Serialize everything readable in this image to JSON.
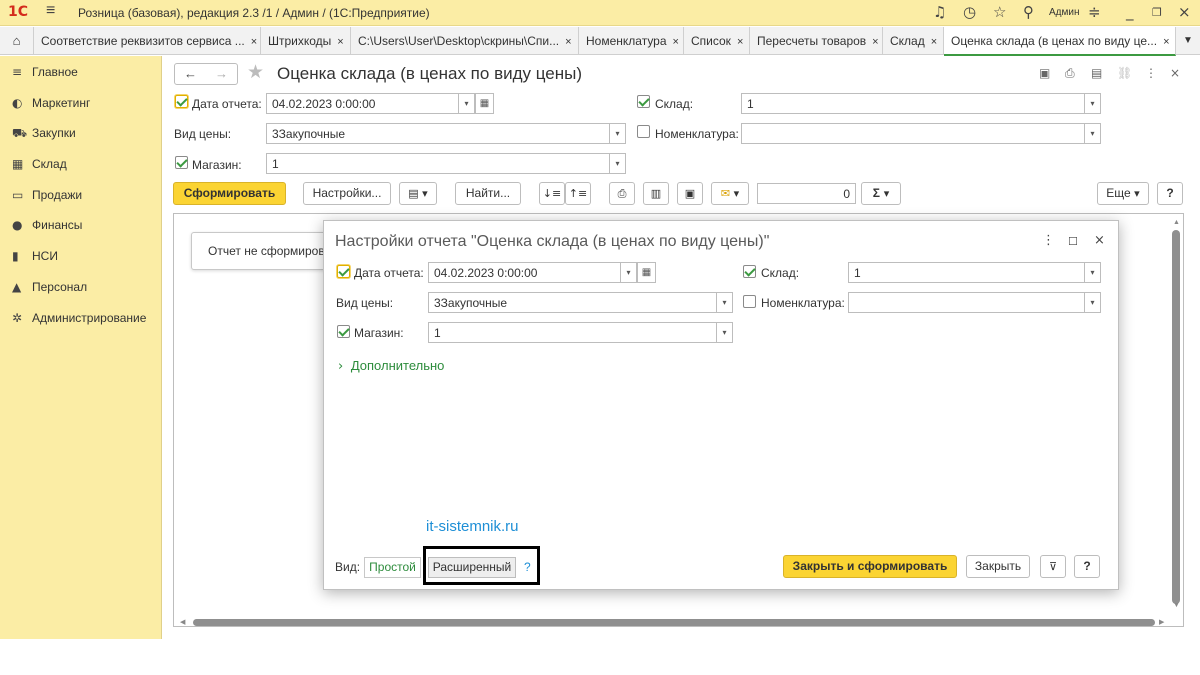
{
  "titlebar": {
    "logo": "1С",
    "title": "Розница (базовая), редакция 2.3 /1 / Админ /  (1С:Предприятие)",
    "user": "Админ"
  },
  "tabs": [
    {
      "label": "Соответствие реквизитов сервиса ...",
      "close": "×"
    },
    {
      "label": "Штрихкоды",
      "close": "×"
    },
    {
      "label": "C:\\Users\\User\\Desktop\\скрины\\Спи...",
      "close": "×"
    },
    {
      "label": "Номенклатура",
      "close": "×"
    },
    {
      "label": "Список",
      "close": "×"
    },
    {
      "label": "Пересчеты товаров",
      "close": "×"
    },
    {
      "label": "Склад",
      "close": "×"
    },
    {
      "label": "Оценка склада (в ценах по виду це...",
      "close": "×"
    }
  ],
  "sidebar": {
    "items": [
      {
        "label": "Главное",
        "icon": "≡"
      },
      {
        "label": "Маркетинг",
        "icon": "◐"
      },
      {
        "label": "Закупки",
        "icon": "⛟"
      },
      {
        "label": "Склад",
        "icon": "▦"
      },
      {
        "label": "Продажи",
        "icon": "▭"
      },
      {
        "label": "Финансы",
        "icon": "●"
      },
      {
        "label": "НСИ",
        "icon": "▮"
      },
      {
        "label": "Персонал",
        "icon": "▲"
      },
      {
        "label": "Администрирование",
        "icon": "✲"
      }
    ]
  },
  "form": {
    "title": "Оценка склада (в ценах по виду цены)",
    "date_label": "Дата отчета:",
    "date_value": "04.02.2023  0:00:00",
    "price_label": "Вид цены:",
    "price_value": "3Закупочные",
    "store_label": "Магазин:",
    "store_value": "1",
    "warehouse_label": "Склад:",
    "warehouse_value": "1",
    "nomen_label": "Номенклатура:",
    "nomen_value": ""
  },
  "toolbar": {
    "generate": "Сформировать",
    "settings": "Настройки...",
    "find": "Найти...",
    "sum_value": "0",
    "sigma": "Σ",
    "more": "Еще",
    "help": "?"
  },
  "report": {
    "not_formed": "Отчет не сформирова"
  },
  "dialog": {
    "title": "Настройки отчета \"Оценка склада (в ценах по виду цены)\"",
    "date_label": "Дата отчета:",
    "date_value": "04.02.2023  0:00:00",
    "price_label": "Вид цены:",
    "price_value": "3Закупочные",
    "store_label": "Магазин:",
    "store_value": "1",
    "warehouse_label": "Склад:",
    "warehouse_value": "1",
    "nomen_label": "Номенклатура:",
    "nomen_value": "",
    "more_label": "Дополнительно",
    "watermark": "it-sistemnik.ru",
    "view_label": "Вид:",
    "view_simple": "Простой",
    "view_extended": "Расширенный",
    "view_help": "?",
    "close_generate": "Закрыть и сформировать",
    "close": "Закрыть",
    "help": "?"
  },
  "colors": {
    "accent_yellow": "#fbd433",
    "panel_yellow": "#fbeda5",
    "green": "#3c9a41",
    "link_blue": "#1e8fd6"
  }
}
